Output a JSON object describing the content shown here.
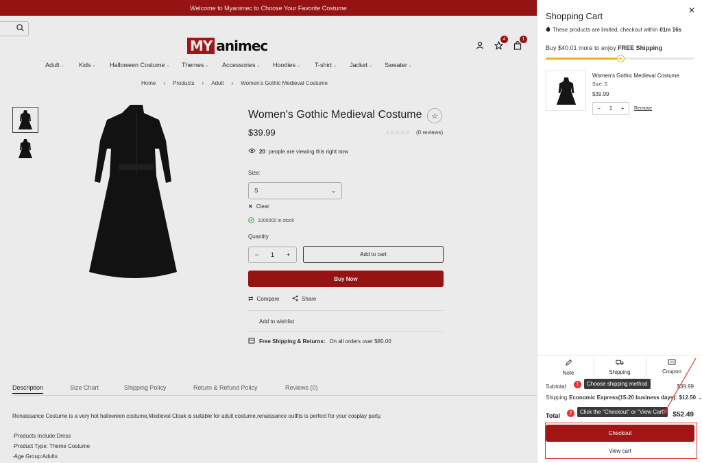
{
  "announcement": "Welcome to Myanimec to Choose Your Favorite Costume",
  "logo": {
    "part1": "MY",
    "part2": "animec"
  },
  "header": {
    "wishlist_count": "4",
    "cart_count": "1"
  },
  "nav": [
    "Adult",
    "Kids",
    "Halloween Costume",
    "Themes",
    "Accessories",
    "Hoodies",
    "T-shirt",
    "Jacket",
    "Sweater"
  ],
  "breadcrumb": [
    "Home",
    "Products",
    "Adult",
    "Women's Gothic Medieval Costume"
  ],
  "breadcrumb_sep": "›",
  "product": {
    "title": "Women's Gothic Medieval Costume",
    "price": "$39.99",
    "stars": "☆☆☆☆☆",
    "reviews": "(0 reviews)",
    "viewing_count": "20",
    "viewing_text": "people are viewing this right now",
    "size_label": "Size:",
    "size_value": "S",
    "clear": "Clear",
    "stock": "1000000 in stock",
    "quantity_label": "Quantity",
    "qty": "1",
    "add_to_cart": "Add to cart",
    "buy_now": "Buy Now",
    "compare": "Compare",
    "share": "Share",
    "wishlist": "Add to wishlist",
    "free_shipping_label": "Free Shipping & Returns:",
    "free_shipping_text": "On all orders over $80.00"
  },
  "tabs": [
    "Description",
    "Size Chart",
    "Shipping Policy",
    "Return & Refund Policy",
    "Reviews (0)"
  ],
  "description": [
    "Renaissance Costume is a very hot halloween costume,Medieval Cloak is suitable for adult costume,renaissance outfits is perfect for your cosplay party.",
    "·Products Include:Dress",
    "·Product Type: Theme Costume",
    "·Age Group:Adults"
  ],
  "cart": {
    "title": "Shopping Cart",
    "close": "✕",
    "limited_text": "These products are limited, checkout within",
    "timer": "01m 16s",
    "buy_more_text": "Buy $40.01 more to enjoy",
    "free_shipping": "FREE Shipping",
    "progress_fraction": 0.5,
    "item": {
      "name": "Women's Gothic Medieval Costume",
      "size": "Size: S",
      "price": "$39.99",
      "qty": "1",
      "remove": "Remove"
    },
    "tools": [
      "Note",
      "Shipping",
      "Coupon"
    ],
    "subtotal_label": "Subtotal",
    "subtotal_value": "$39.99",
    "shipping_label": "Shipping",
    "shipping_method": "Economic Express(15-20 business days):",
    "shipping_value": "$12.50",
    "total_label": "Total",
    "total_value": "$52.49",
    "checkout": "Checkout",
    "view_cart": "View cart"
  },
  "annotations": {
    "tip1_num": "1",
    "tip1": "Choose shipping method",
    "tip2_num": "2",
    "tip2": "Click the \"Checkout\" or \"View Cart\""
  },
  "colors": {
    "brand": "#a31515",
    "accent_star": "#f2b01e",
    "annotation": "#e53333"
  }
}
